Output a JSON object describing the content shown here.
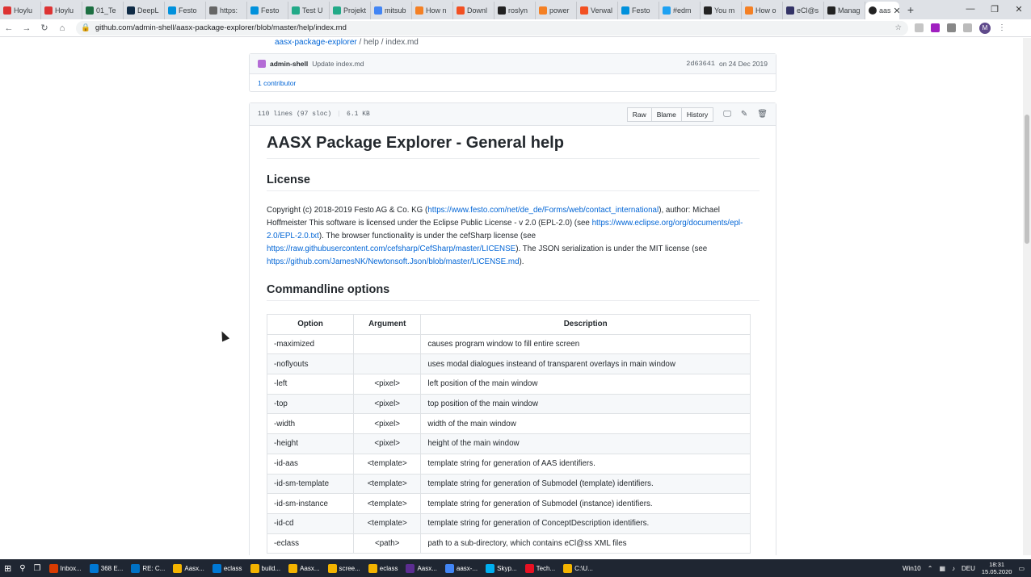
{
  "browser": {
    "tabs": [
      {
        "label": "Hoylu",
        "color": "#d33"
      },
      {
        "label": "Hoylu",
        "color": "#d33"
      },
      {
        "label": "01_Te",
        "color": "#1d6f42"
      },
      {
        "label": "DeepL",
        "color": "#0f2b46"
      },
      {
        "label": "Festo",
        "color": "#0091dc"
      },
      {
        "label": "https:",
        "color": "#666"
      },
      {
        "label": "Festo",
        "color": "#0091dc"
      },
      {
        "label": "Test U",
        "color": "#2a8"
      },
      {
        "label": "Projekt",
        "color": "#2a8"
      },
      {
        "label": "mitsub",
        "color": "#4285f4"
      },
      {
        "label": "How n",
        "color": "#f48024"
      },
      {
        "label": "Downl",
        "color": "#f25022"
      },
      {
        "label": "roslyn",
        "color": "#222"
      },
      {
        "label": "power",
        "color": "#f48024"
      },
      {
        "label": "Verwal",
        "color": "#f25022"
      },
      {
        "label": "Festo",
        "color": "#0091dc"
      },
      {
        "label": "#edm",
        "color": "#1da1f2"
      },
      {
        "label": "You m",
        "color": "#222"
      },
      {
        "label": "How o",
        "color": "#f48024"
      },
      {
        "label": "eCl@s",
        "color": "#336"
      },
      {
        "label": "Manag",
        "color": "#222"
      }
    ],
    "active_tab": {
      "label": "aas",
      "close": "✕"
    },
    "new_tab": "+",
    "window_controls": {
      "minimize": "—",
      "maximize": "❐",
      "close": "✕"
    },
    "url": "github.com/admin-shell/aasx-package-explorer/blob/master/help/index.md",
    "avatar_letter": "M"
  },
  "breadcrumb": {
    "repo": "aasx-package-explorer",
    "rest": " / help / index.md"
  },
  "commit": {
    "author": "admin-shell",
    "message": "Update index.md",
    "sha": "2d63641",
    "date": "on 24 Dec 2019",
    "contributors": "1 contributor"
  },
  "file": {
    "lines": "110 lines (97 sloc)",
    "size": "6.1 KB",
    "buttons": {
      "raw": "Raw",
      "blame": "Blame",
      "history": "History"
    }
  },
  "content": {
    "title": "AASX Package Explorer - General help",
    "license_heading": "License",
    "license_p1": "Copyright (c) 2018-2019 Festo AG & Co. KG (",
    "license_link1": "https://www.festo.com/net/de_de/Forms/web/contact_international",
    "license_p2": "), author: Michael Hoffmeister This software is licensed under the Eclipse Public License - v 2.0 (EPL-2.0) (see ",
    "license_link2": "https://www.eclipse.org/org/documents/epl-2.0/EPL-2.0.txt",
    "license_p3": "). The browser functionality is under the cefSharp license (see ",
    "license_link3": "https://raw.githubusercontent.com/cefsharp/CefSharp/master/LICENSE",
    "license_p4": "). The JSON serialization is under the MIT license (see ",
    "license_link4": "https://github.com/JamesNK/Newtonsoft.Json/blob/master/LICENSE.md",
    "license_p5": ").",
    "options_heading": "Commandline options",
    "table_headers": [
      "Option",
      "Argument",
      "Description"
    ],
    "rows": [
      [
        "-maximized",
        "",
        "causes program window to fill entire screen"
      ],
      [
        "-noflyouts",
        "",
        "uses modal dialogues insteand of transparent overlays in main window"
      ],
      [
        "-left",
        "<pixel>",
        "left position of the main window"
      ],
      [
        "-top",
        "<pixel>",
        "top position of the main window"
      ],
      [
        "-width",
        "<pixel>",
        "width of the main window"
      ],
      [
        "-height",
        "<pixel>",
        "height of the main window"
      ],
      [
        "-id-aas",
        "<template>",
        "template string for generation of AAS identifiers."
      ],
      [
        "-id-sm-template",
        "<template>",
        "template string for generation of Submodel (template) identifiers."
      ],
      [
        "-id-sm-instance",
        "<template>",
        "template string for generation of Submodel (instance) identifiers."
      ],
      [
        "-id-cd",
        "<template>",
        "template string for generation of ConceptDescription identifiers."
      ],
      [
        "-eclass",
        "<path>",
        "path to a sub-directory, which contains eCl@ss XML files"
      ]
    ]
  },
  "taskbar": {
    "items": [
      "Inbox...",
      "368 E...",
      "RE: C...",
      "Aasx...",
      "eclass",
      "build...",
      "Aasx...",
      "scree...",
      "eclass",
      "Aasx...",
      "aasx-...",
      "Skyp...",
      "Tech...",
      "C:\\U..."
    ],
    "desktop_label": "Win10",
    "lang": "DEU",
    "time": "18:31",
    "date": "15.05.2020"
  }
}
